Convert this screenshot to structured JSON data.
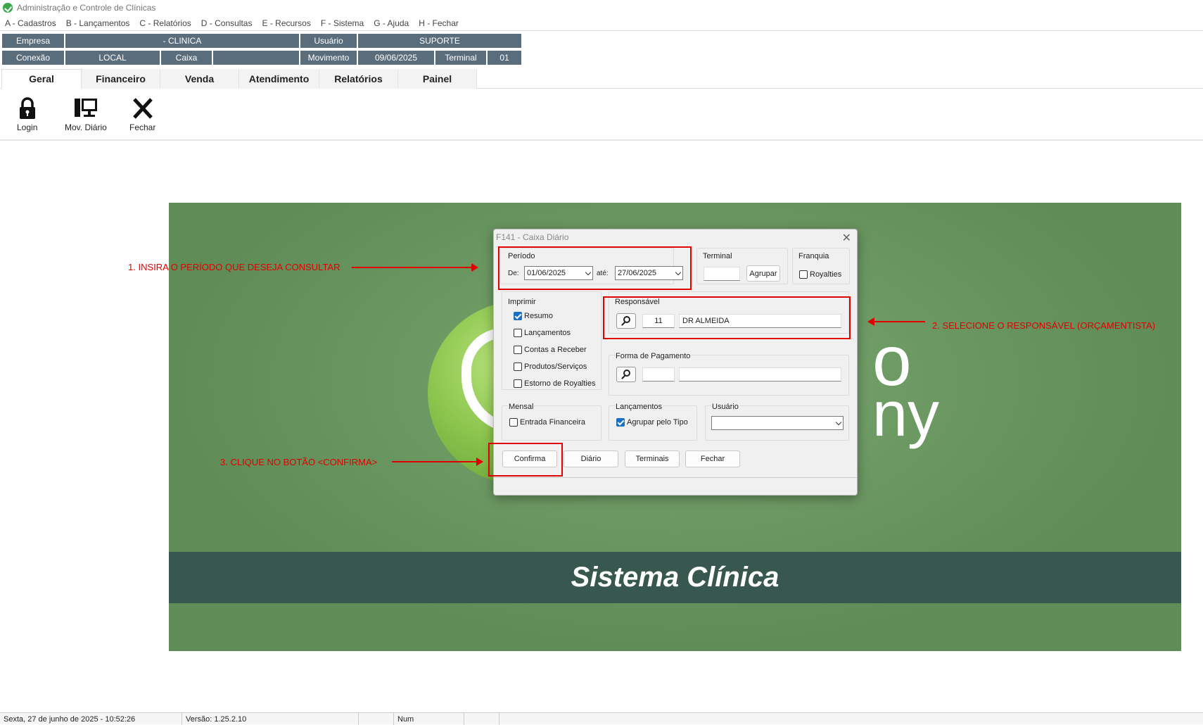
{
  "window": {
    "title": "Administração e Controle de Clínicas"
  },
  "menu": [
    "A - Cadastros",
    "B - Lançamentos",
    "C - Relatórios",
    "D - Consultas",
    "E - Recursos",
    "F - Sistema",
    "G - Ajuda",
    "H - Fechar"
  ],
  "info": {
    "empresa_label": "Empresa",
    "empresa_value": "- CLINICA",
    "usuario_label": "Usuário",
    "usuario_value": "SUPORTE",
    "conexao_label": "Conexão",
    "conexao_value": "LOCAL",
    "caixa_label": "Caixa",
    "caixa_value": "",
    "movimento_label": "Movimento",
    "movimento_value": "09/06/2025",
    "terminal_label": "Terminal",
    "terminal_value": "01"
  },
  "tabs": [
    "Geral",
    "Financeiro",
    "Venda",
    "Atendimento",
    "Relatórios",
    "Painel"
  ],
  "active_tab": "Geral",
  "ribbon": {
    "login": "Login",
    "mov_diario": "Mov. Diário",
    "fechar": "Fechar"
  },
  "banner": {
    "text": "Sistema Clínica",
    "logo_partial": "o",
    "logo_partial2": "ny"
  },
  "dialog": {
    "title": "F141 - Caixa Diário",
    "periodo": {
      "label": "Período",
      "de_label": "De:",
      "de_value": "01/06/2025",
      "ate_label": "até:",
      "ate_value": "27/06/2025"
    },
    "terminal": {
      "label": "Terminal",
      "value": "",
      "agrupar": "Agrupar"
    },
    "franquia": {
      "label": "Franquia",
      "royalties": "Royalties",
      "royalties_checked": false
    },
    "imprimir": {
      "label": "Imprimir",
      "items": [
        {
          "label": "Resumo",
          "checked": true
        },
        {
          "label": "Lançamentos",
          "checked": false
        },
        {
          "label": "Contas a Receber",
          "checked": false
        },
        {
          "label": "Produtos/Serviços",
          "checked": false
        },
        {
          "label": "Estorno de Royalties",
          "checked": false
        }
      ]
    },
    "responsavel": {
      "label": "Responsável",
      "code": "11",
      "name": "DR ALMEIDA"
    },
    "forma_pagamento": {
      "label": "Forma de Pagamento",
      "code": "",
      "name": ""
    },
    "mensal": {
      "label": "Mensal",
      "entrada": "Entrada Financeira",
      "entrada_checked": false
    },
    "lancamentos": {
      "label": "Lançamentos",
      "agrupar": "Agrupar pelo Tipo",
      "agrupar_checked": true
    },
    "usuario": {
      "label": "Usuário",
      "value": ""
    },
    "buttons": {
      "confirma": "Confirma",
      "diario": "Diário",
      "terminais": "Terminais",
      "fechar": "Fechar"
    }
  },
  "annotations": {
    "a1": "1. INSIRA O PERÍODO QUE DESEJA CONSULTAR",
    "a2": "2. SELECIONE O RESPONSÁVEL (ORÇAMENTISTA)",
    "a3": "3. CLIQUE NO BOTÃO <CONFIRMA>"
  },
  "status": {
    "datetime": "Sexta, 27 de junho de 2025 - 10:52:26",
    "version": "Versão: 1.25.2.10",
    "num": "Num"
  },
  "colors": {
    "info_bg": "#5a6d7d",
    "banner_bg": "#6a9460",
    "band": "#37574f",
    "annotation": "#e00000"
  }
}
